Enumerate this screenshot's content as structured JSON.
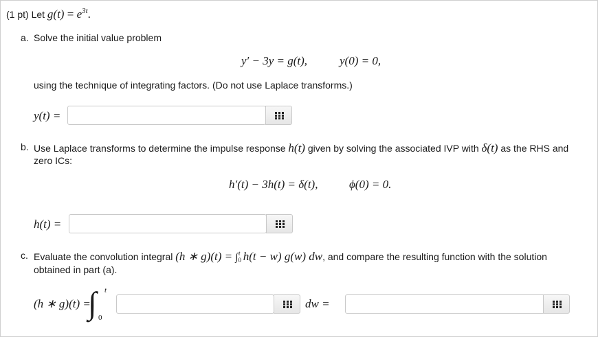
{
  "question": {
    "points": "(1 pt) Let",
    "def_lhs": "g(t)",
    "def_eq": " = ",
    "def_base": "e",
    "def_exp": "3t",
    "def_end": "."
  },
  "part_a": {
    "marker": "a.",
    "intro": "Solve the initial value problem",
    "eq_lhs": "y′ − 3y = g(t),",
    "eq_ic": "y(0) = 0,",
    "instruction": "using the technique of integrating factors. (Do not use Laplace transforms.)",
    "answer_label": "y(t) =",
    "answer_value": ""
  },
  "part_b": {
    "marker": "b.",
    "intro_1": "Use Laplace transforms to determine the impulse response",
    "intro_h": "h(t)",
    "intro_2": "given by solving the associated IVP with",
    "intro_delta": "δ(t)",
    "intro_3": "as the RHS and",
    "intro_line2": "zero ICs:",
    "eq_lhs": "h′(t) − 3h(t) = δ(t),",
    "eq_ic": "ϕ(0) = 0.",
    "answer_label": "h(t) =",
    "answer_value": ""
  },
  "part_c": {
    "marker": "c.",
    "intro_1": "Evaluate the convolution integral",
    "conv": "(h ∗ g)(t) = ",
    "integral": "∫",
    "int_upper": "t",
    "int_lower": "0",
    "integrand": "h(t − w) g(w) dw",
    "intro_2": ", and compare the resulting function with the solution",
    "intro_line2": "obtained in part (a).",
    "answer_label": "(h ∗ g)(t) =",
    "big_integral": "∫",
    "big_upper": "t",
    "big_lower": "0",
    "dw_label": "dw =",
    "integrand_value": "",
    "result_value": ""
  },
  "icons": {
    "palette": "equation-palette-grid-icon"
  }
}
